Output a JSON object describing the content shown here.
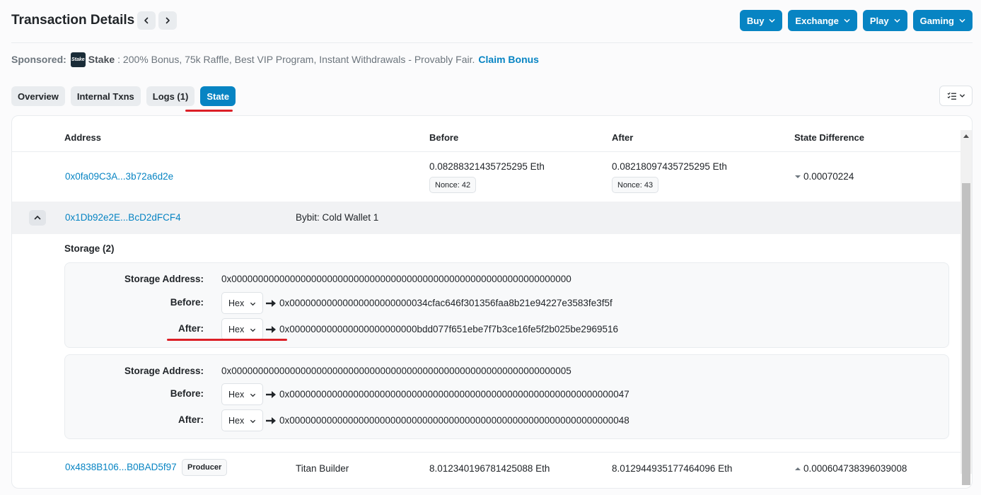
{
  "header": {
    "title": "Transaction Details"
  },
  "top_menu": [
    {
      "label": "Buy"
    },
    {
      "label": "Exchange"
    },
    {
      "label": "Play"
    },
    {
      "label": "Gaming"
    }
  ],
  "sponsor": {
    "label": "Sponsored:",
    "logo_text": "Stake",
    "brand": "Stake",
    "text": ": 200% Bonus, 75k Raffle, Best VIP Program, Instant Withdrawals - Provably Fair.",
    "cta": "Claim Bonus"
  },
  "tabs": [
    {
      "label": "Overview"
    },
    {
      "label": "Internal Txns"
    },
    {
      "label": "Logs (1)"
    },
    {
      "label": "State"
    }
  ],
  "table": {
    "columns": [
      "Address",
      "Before",
      "After",
      "State Difference"
    ],
    "rows": [
      {
        "address": "0x0fa09C3A...3b72a6d2e",
        "before": "0.08288321435725295 Eth",
        "before_nonce": "Nonce: 42",
        "after": "0.08218097435725295 Eth",
        "after_nonce": "Nonce: 43",
        "diff": "0.00070224"
      },
      {
        "address": "0x1Db92e2E...BcD2dFCF4",
        "name": "Bybit: Cold Wallet 1"
      },
      {
        "address": "0x4838B106...B0BAD5f97",
        "badge": "Producer",
        "name": "Titan Builder",
        "before": "8.012340196781425088 Eth",
        "after": "8.012944935177464096 Eth",
        "diff": "0.000604738396039008"
      }
    ]
  },
  "storage": {
    "title": "Storage (2)",
    "labels": {
      "address": "Storage Address:",
      "before": "Before:",
      "after": "After:"
    },
    "format": "Hex",
    "entries": [
      {
        "address": "0x0000000000000000000000000000000000000000000000000000000000000000",
        "before": "0x00000000000000000000000034cfac646f301356faa8b21e94227e3583fe3f5f",
        "after": "0x000000000000000000000000bdd077f651ebe7f7b3ce16fe5f2b025be2969516"
      },
      {
        "address": "0x0000000000000000000000000000000000000000000000000000000000000005",
        "before": "0x0000000000000000000000000000000000000000000000000000000000000047",
        "after": "0x0000000000000000000000000000000000000000000000000000000000000048"
      }
    ]
  }
}
